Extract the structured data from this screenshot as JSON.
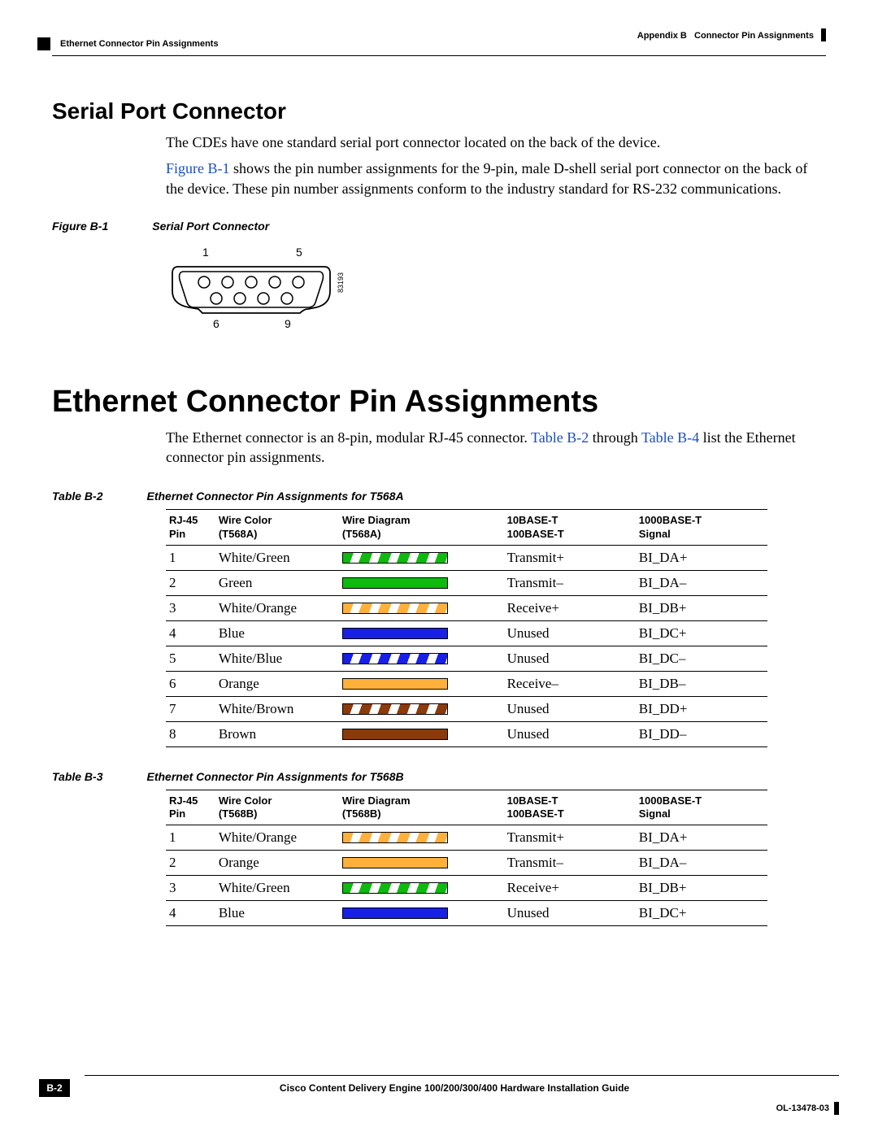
{
  "header": {
    "left_section": "Ethernet Connector Pin Assignments",
    "right_appendix": "Appendix B",
    "right_title": "Connector Pin Assignments"
  },
  "section1": {
    "heading": "Serial Port Connector",
    "p1": "The CDEs have one standard serial port connector located on the back of the device.",
    "p2_pre": "",
    "p2_link": "Figure B-1",
    "p2_post": " shows the pin number assignments for the 9-pin, male D-shell serial port connector on the back of the device. These pin number assignments conform to the industry standard for RS-232 communications.",
    "figure": {
      "label": "Figure B-1",
      "title": "Serial Port Connector",
      "pin_labels": {
        "top_left": "1",
        "top_right": "5",
        "bottom_left": "6",
        "bottom_right": "9"
      },
      "side_number": "83193"
    }
  },
  "section2": {
    "heading": "Ethernet Connector Pin Assignments",
    "p1_a": "The Ethernet connector is an 8-pin, modular RJ-45 connector. ",
    "p1_link1": "Table B-2",
    "p1_b": " through ",
    "p1_link2": "Table B-4",
    "p1_c": " list the Ethernet connector pin assignments."
  },
  "table_b2": {
    "label": "Table B-2",
    "title": "Ethernet Connector Pin Assignments for T568A",
    "columns": {
      "c1a": "RJ-45",
      "c1b": "Pin",
      "c2a": "Wire Color",
      "c2b": "(T568A)",
      "c3a": "Wire Diagram",
      "c3b": "(T568A)",
      "c4a": "10BASE-T",
      "c4b": "100BASE-T",
      "c5a": "1000BASE-T",
      "c5b": "Signal"
    },
    "rows": [
      {
        "pin": "1",
        "color": "White/Green",
        "wire": {
          "type": "stripe",
          "clr": "green"
        },
        "tb": "Transmit+",
        "gb": "BI_DA+"
      },
      {
        "pin": "2",
        "color": "Green",
        "wire": {
          "type": "solid",
          "clr": "green"
        },
        "tb": "Transmit–",
        "gb": "BI_DA–"
      },
      {
        "pin": "3",
        "color": "White/Orange",
        "wire": {
          "type": "stripe",
          "clr": "orange"
        },
        "tb": "Receive+",
        "gb": "BI_DB+"
      },
      {
        "pin": "4",
        "color": "Blue",
        "wire": {
          "type": "solid",
          "clr": "blue"
        },
        "tb": "Unused",
        "gb": "BI_DC+"
      },
      {
        "pin": "5",
        "color": "White/Blue",
        "wire": {
          "type": "stripe",
          "clr": "blue"
        },
        "tb": "Unused",
        "gb": "BI_DC–"
      },
      {
        "pin": "6",
        "color": "Orange",
        "wire": {
          "type": "solid",
          "clr": "orange"
        },
        "tb": "Receive–",
        "gb": "BI_DB–"
      },
      {
        "pin": "7",
        "color": "White/Brown",
        "wire": {
          "type": "stripe",
          "clr": "brown"
        },
        "tb": "Unused",
        "gb": "BI_DD+"
      },
      {
        "pin": "8",
        "color": "Brown",
        "wire": {
          "type": "solid",
          "clr": "brown"
        },
        "tb": "Unused",
        "gb": "BI_DD–"
      }
    ]
  },
  "table_b3": {
    "label": "Table B-3",
    "title": "Ethernet Connector Pin Assignments for T568B",
    "columns": {
      "c1a": "RJ-45",
      "c1b": "Pin",
      "c2a": "Wire Color",
      "c2b": "(T568B)",
      "c3a": "Wire Diagram",
      "c3b": "(T568B)",
      "c4a": "10BASE-T",
      "c4b": "100BASE-T",
      "c5a": "1000BASE-T",
      "c5b": "Signal"
    },
    "rows": [
      {
        "pin": "1",
        "color": "White/Orange",
        "wire": {
          "type": "stripe",
          "clr": "orange"
        },
        "tb": "Transmit+",
        "gb": "BI_DA+"
      },
      {
        "pin": "2",
        "color": "Orange",
        "wire": {
          "type": "solid",
          "clr": "orange"
        },
        "tb": "Transmit–",
        "gb": "BI_DA–"
      },
      {
        "pin": "3",
        "color": "White/Green",
        "wire": {
          "type": "stripe",
          "clr": "green"
        },
        "tb": "Receive+",
        "gb": "BI_DB+"
      },
      {
        "pin": "4",
        "color": "Blue",
        "wire": {
          "type": "solid",
          "clr": "blue"
        },
        "tb": "Unused",
        "gb": "BI_DC+"
      }
    ]
  },
  "footer": {
    "guide": "Cisco Content Delivery Engine 100/200/300/400 Hardware Installation Guide",
    "page": "B-2",
    "docnum": "OL-13478-03"
  }
}
